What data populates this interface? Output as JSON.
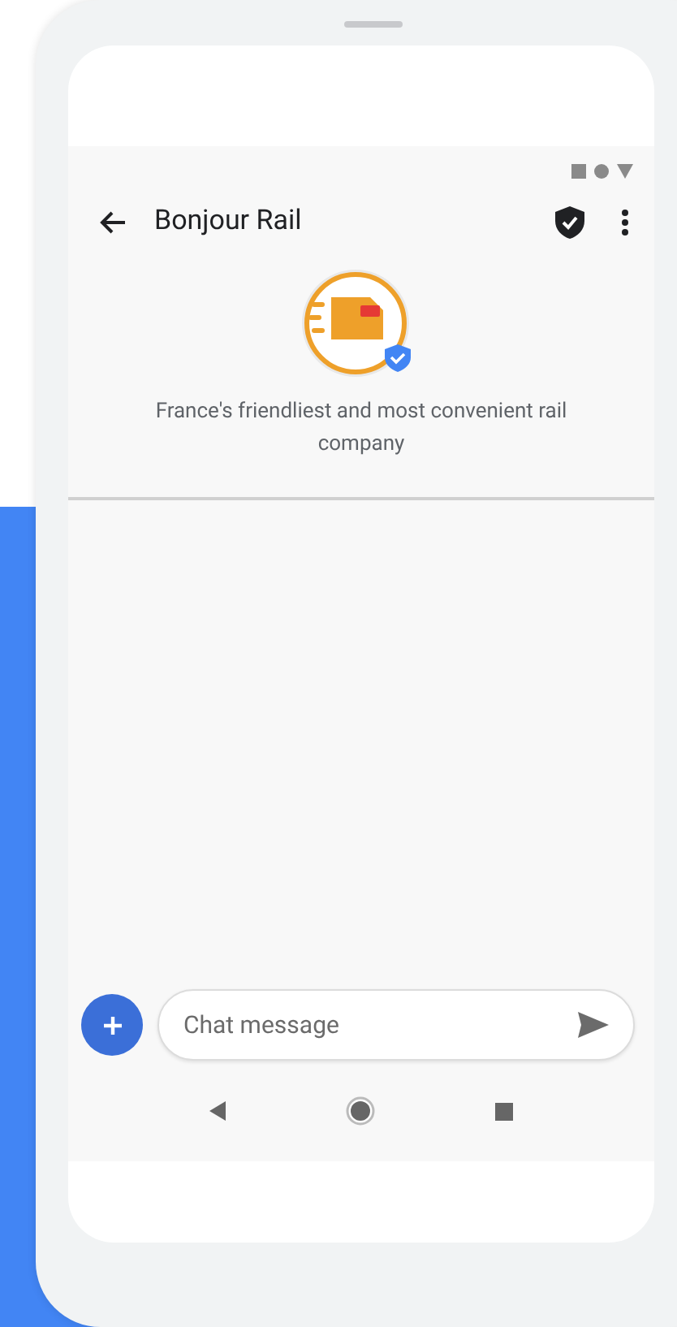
{
  "app_bar": {
    "title": "Bonjour Rail"
  },
  "profile": {
    "description": "France's friendliest and most convenient rail company"
  },
  "composer": {
    "placeholder": "Chat message"
  }
}
